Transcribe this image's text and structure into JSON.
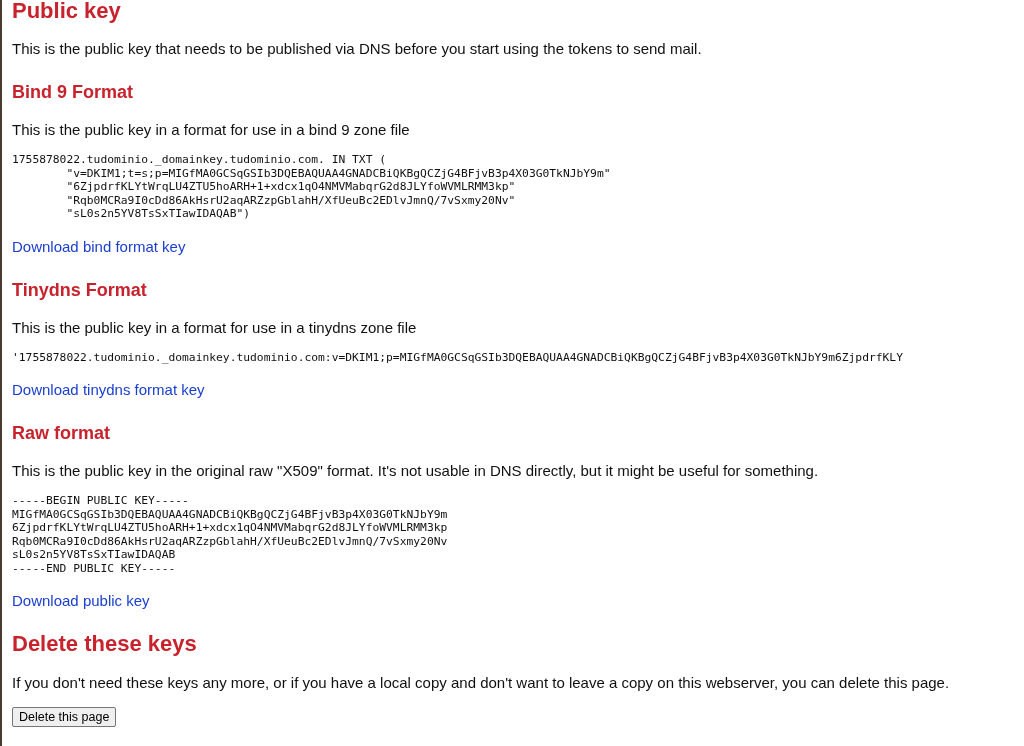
{
  "title": "Public key",
  "intro": "This is the public key that needs to be published via DNS before you start using the tokens to send mail.",
  "formats": [
    {
      "heading": "Bind 9 Format",
      "description": "This is the public key in a format for use in a bind 9 zone file",
      "code": [
        "1755878022.tudominio._domainkey.tudominio.com. IN TXT (",
        "        \"v=DKIM1;t=s;p=MIGfMA0GCSqGSIb3DQEBAQUAA4GNADCBiQKBgQCZjG4BFjvB3p4X03G0TkNJbY9m\"",
        "        \"6ZjpdrfKLYtWrqLU4ZTU5hoARH+1+xdcx1qO4NMVMabqrG2d8JLYfoWVMLRMM3kp\"",
        "        \"Rqb0MCRa9I0cDd86AkHsrU2aqARZzpGblahH/XfUeuBc2EDlvJmnQ/7vSxmy20Nv\"",
        "        \"sL0s2n5YV8TsSxTIawIDAQAB\")"
      ],
      "link": "Download bind format key"
    },
    {
      "heading": "Tinydns Format",
      "description": "This is the public key in a format for use in a tinydns zone file",
      "code": [
        "'1755878022.tudominio._domainkey.tudominio.com:v=DKIM1;p=MIGfMA0GCSqGSIb3DQEBAQUAA4GNADCBiQKBgQCZjG4BFjvB3p4X03G0TkNJbY9m6ZjpdrfKLY"
      ],
      "link": "Download tinydns format key"
    },
    {
      "heading": "Raw format",
      "description": "This is the public key in the original raw \"X509\" format. It's not usable in DNS directly, but it might be useful for something.",
      "code": [
        "-----BEGIN PUBLIC KEY-----",
        "MIGfMA0GCSqGSIb3DQEBAQUAA4GNADCBiQKBgQCZjG4BFjvB3p4X03G0TkNJbY9m",
        "6ZjpdrfKLYtWrqLU4ZTU5hoARH+1+xdcx1qO4NMVMabqrG2d8JLYfoWVMLRMM3kp",
        "Rqb0MCRa9I0cDd86AkHsrU2aqARZzpGblahH/XfUeuBc2EDlvJmnQ/7vSxmy20Nv",
        "sL0s2n5YV8TsSxTIawIDAQAB",
        "-----END PUBLIC KEY-----"
      ],
      "link": "Download public key"
    }
  ],
  "delete": {
    "heading": "Delete these keys",
    "description": "If you don't need these keys any more, or if you have a local copy and don't want to leave a copy on this webserver, you can delete this page.",
    "button": "Delete this page"
  }
}
